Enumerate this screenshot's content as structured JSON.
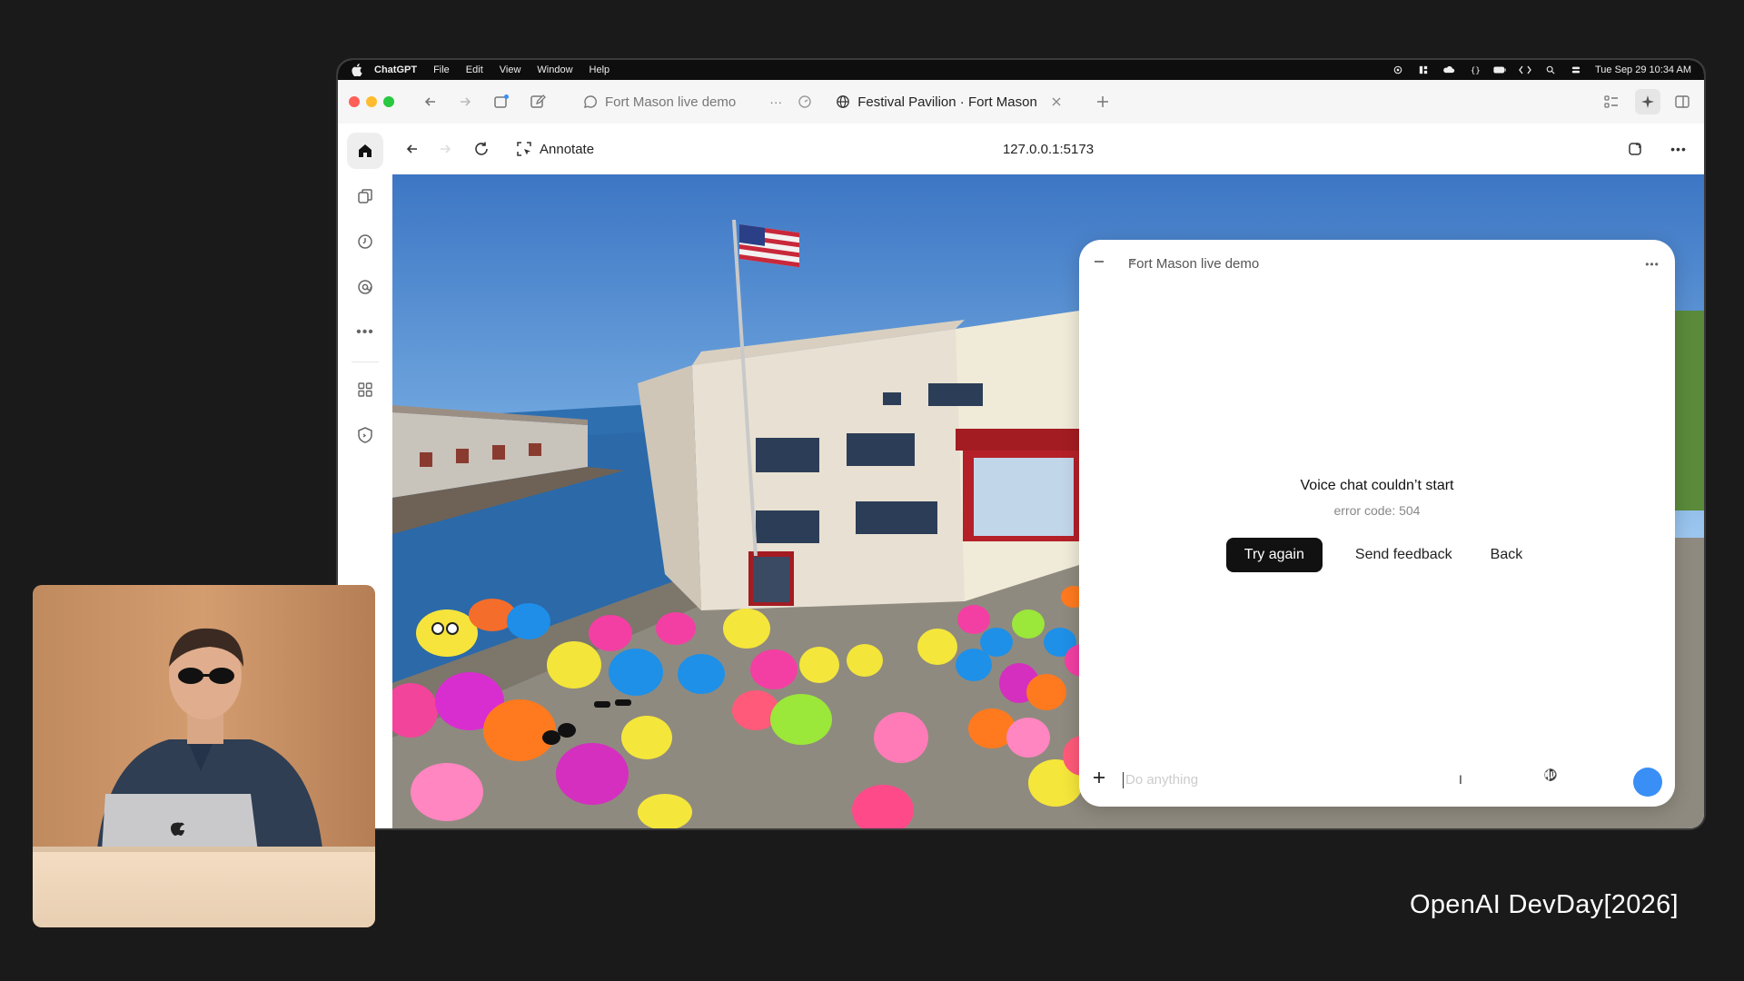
{
  "menubar": {
    "app_name": "ChatGPT",
    "items": [
      "File",
      "Edit",
      "View",
      "Window",
      "Help"
    ],
    "clock": "Tue Sep 29  10:34 AM"
  },
  "tabs": [
    {
      "label": "Fort Mason live demo",
      "active": false
    },
    {
      "label": "Festival Pavilion · Fort Mason",
      "active": true
    }
  ],
  "addressbar": {
    "annotate_label": "Annotate",
    "url": "127.0.0.1:5173"
  },
  "dialog": {
    "title": "Fort Mason live demo",
    "error_title": "Voice chat couldn’t start",
    "error_code": "error code: 504",
    "buttons": {
      "try_again": "Try again",
      "send_feedback": "Send feedback",
      "back": "Back"
    },
    "composer_placeholder": "Do anything"
  },
  "brand": "OpenAI DevDay[2026]",
  "colors": {
    "accent_blue": "#3a8ff6",
    "close": "#ff5f57",
    "minimize": "#febc2e",
    "zoom": "#28c840",
    "primary_button": "#111111"
  }
}
